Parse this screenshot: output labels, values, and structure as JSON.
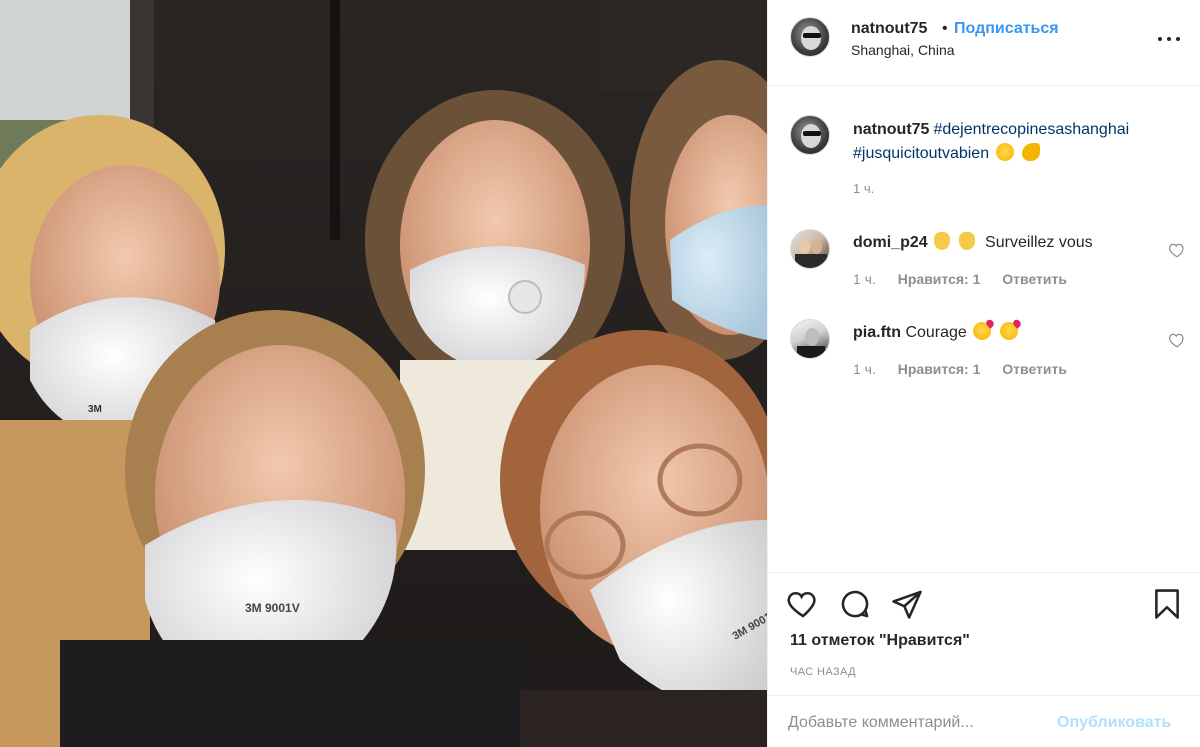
{
  "post": {
    "author": "natnout75",
    "separator": "•",
    "follow_label": "Подписаться",
    "location": "Shanghai, China",
    "more_icon": "more-options-icon"
  },
  "caption": {
    "author": "natnout75",
    "hashtag1": "#dejentrecopinesashanghai",
    "hashtag2": "#jusquicitoutvabien",
    "emojis": [
      "flushed-face-emoji",
      "flexed-biceps-emoji"
    ],
    "time": "1 ч."
  },
  "comments": [
    {
      "author": "domi_p24",
      "emojis": [
        "clapping-hands-emoji",
        "clapping-hands-emoji"
      ],
      "text": "Surveillez vous",
      "time": "1 ч.",
      "likes_label": "Нравится: 1",
      "reply_label": "Ответить"
    },
    {
      "author": "pia.ftn",
      "text": "Courage",
      "emojis": [
        "kissing-face-emoji",
        "kissing-face-emoji"
      ],
      "time": "1 ч.",
      "likes_label": "Нравится: 1",
      "reply_label": "Ответить"
    }
  ],
  "actions": {
    "icons": [
      "heart-icon",
      "comment-icon",
      "share-icon",
      "bookmark-icon"
    ],
    "likes": "11 отметок \"Нравится\"",
    "posted": "ЧАС НАЗАД"
  },
  "comment_box": {
    "placeholder": "Добавьте комментарий...",
    "publish_label": "Опубликовать"
  },
  "colors": {
    "link": "#3897f0",
    "hashtag": "#003569",
    "secondary_text": "#8e8e8e",
    "publish_disabled": "#b2dffc",
    "border": "#efefef"
  }
}
